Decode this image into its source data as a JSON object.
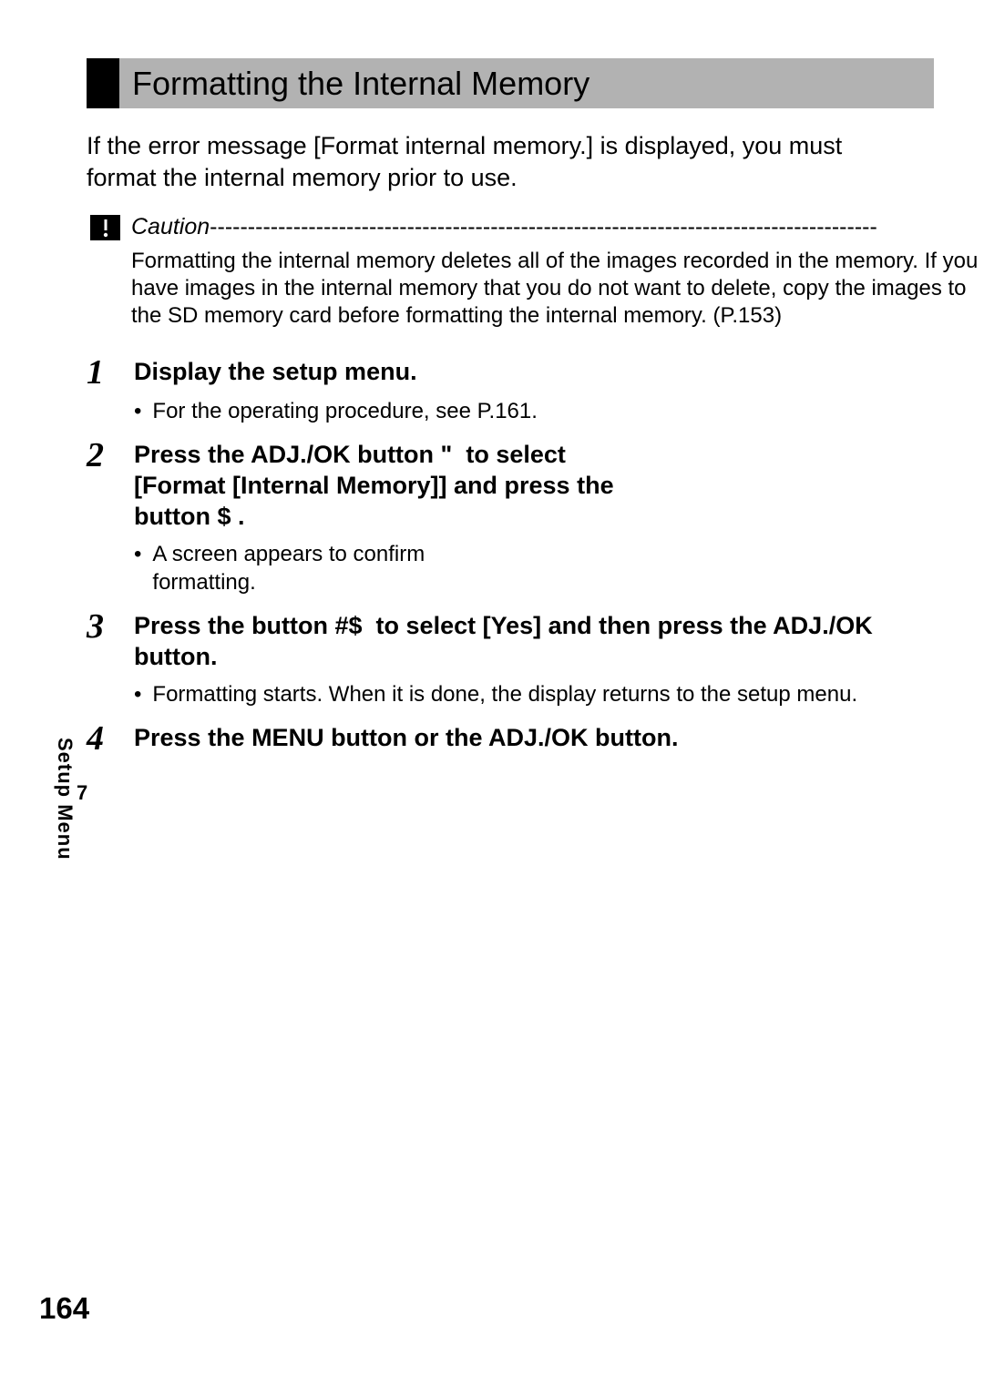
{
  "section_title": "Formatting the Internal Memory",
  "intro": "If the error message [Format internal memory.] is displayed, you must format the internal memory prior to use.",
  "caution": {
    "label": "Caution",
    "dashes": "----------------------------------------------------------------------------------------",
    "body": "Formatting the internal memory deletes all of the images recorded in the memory. If you have images in the internal memory that you do not want to delete, copy the images to the SD memory card before formatting the internal memory. (P.153)"
  },
  "steps": [
    {
      "num": "1",
      "title": "Display the setup menu.",
      "bullets": [
        "For the operating procedure, see P.161."
      ],
      "wide": true
    },
    {
      "num": "2",
      "title": "Press the ADJ./OK button \"  to select [Format [Internal Memory]] and press the button $ .",
      "bullets": [
        "A screen appears to confirm formatting."
      ],
      "narrow": true
    },
    {
      "num": "3",
      "title": "Press the button #$  to select [Yes] and then press the ADJ./OK button.",
      "bullets": [
        "Formatting starts. When it is done, the display returns to the setup menu."
      ],
      "wide": true
    },
    {
      "num": "4",
      "title": "Press the MENU button or the ADJ./OK button.",
      "bullets": [],
      "wide": true
    }
  ],
  "side": {
    "chapter_num": "7",
    "chapter_label": "Setup Menu"
  },
  "page_number": "164"
}
